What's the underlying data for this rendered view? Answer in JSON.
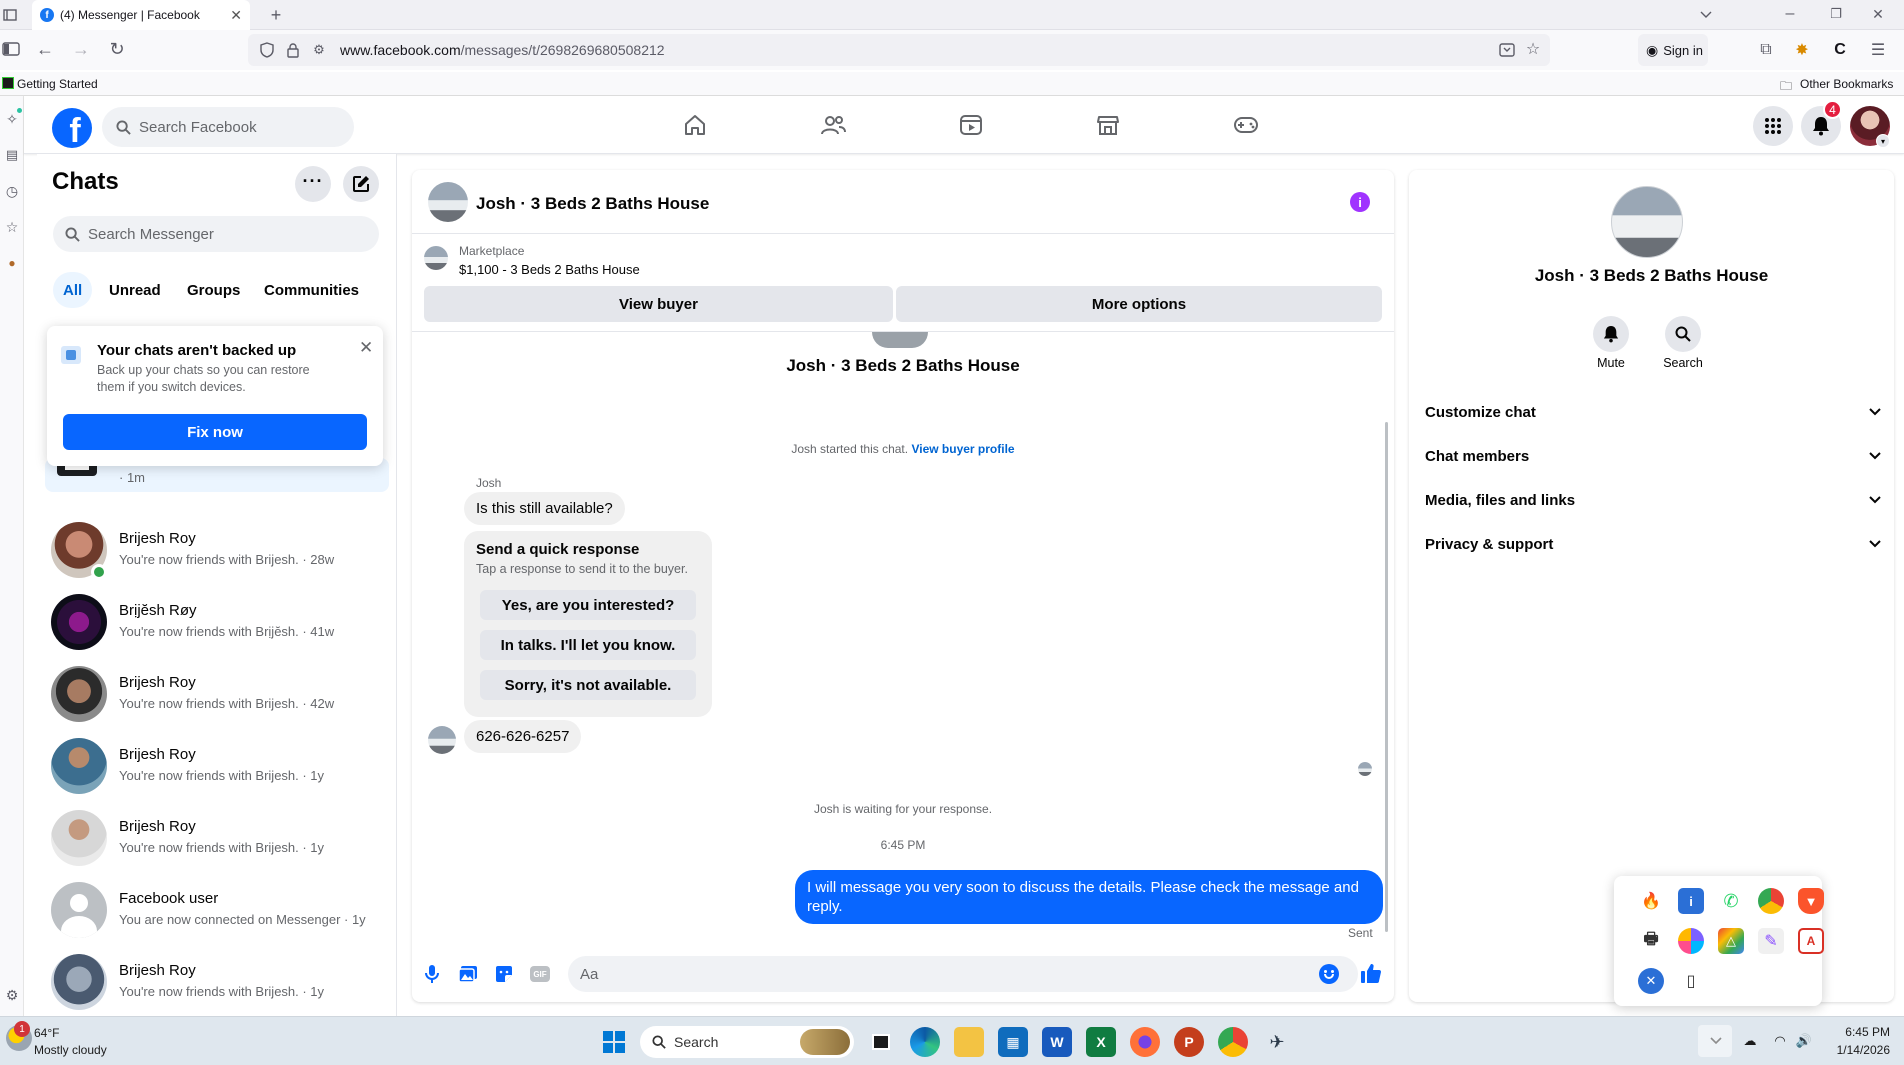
{
  "browser": {
    "tab_title": "(4) Messenger | Facebook",
    "url_domain": "www.facebook.com",
    "url_path": "/messages/t/2698269680508212",
    "sign_in": "Sign in",
    "bookmark_getting_started": "Getting Started",
    "bookmark_other": "Other Bookmarks"
  },
  "header": {
    "search_placeholder": "Search Facebook",
    "notification_count": "4"
  },
  "chats": {
    "title": "Chats",
    "search_placeholder": "Search Messenger",
    "filters": [
      "All",
      "Unread",
      "Groups",
      "Communities"
    ],
    "backup_title": "Your chats aren't backed up",
    "backup_body": "Back up your chats so you can restore them if you switch devices.",
    "fix_now": "Fix now",
    "partial_time": "· 1m",
    "rows": [
      {
        "name": "Brijesh Roy",
        "preview": "You're now friends with Brijesh. · 28w"
      },
      {
        "name": "Brịjĕsh Røy",
        "preview": "You're now friends with Brịjĕsh. · 41w"
      },
      {
        "name": "Brijesh Roy",
        "preview": "You're now friends with Brijesh. · 42w"
      },
      {
        "name": "Brijesh Roy",
        "preview": "You're now friends with Brijesh. · 1y"
      },
      {
        "name": "Brijesh Roy",
        "preview": "You're now friends with Brijesh. · 1y"
      },
      {
        "name": "Facebook user",
        "preview": "You are now connected on Messenger · 1y"
      },
      {
        "name": "Brijesh Roy",
        "preview": "You're now friends with Brijesh. · 1y"
      }
    ]
  },
  "conversation": {
    "title": "Josh · 3 Beds 2 Baths House",
    "marketplace_label": "Marketplace",
    "listing": "$1,100 - 3 Beds 2 Baths House",
    "view_buyer": "View buyer",
    "more_options": "More options",
    "center_name": "Josh · 3 Beds 2 Baths House",
    "started_note": "Josh started this chat.",
    "view_buyer_profile": "View buyer profile",
    "sender_name": "Josh",
    "msg1": "Is this still available?",
    "quick_title": "Send a quick response",
    "quick_sub": "Tap a response to send it to the buyer.",
    "quick_responses": [
      "Yes, are you interested?",
      "In talks. I'll let you know.",
      "Sorry, it's not available."
    ],
    "msg2": "626-626-6257",
    "waiting_note": "Josh is waiting for your response.",
    "time": "6:45 PM",
    "outgoing": "I will message you very soon to discuss the details. Please check the message and reply.",
    "sent": "Sent",
    "composer_placeholder": "Aa"
  },
  "info": {
    "name": "Josh · 3 Beds 2 Baths House",
    "mute": "Mute",
    "search": "Search",
    "sections": [
      "Customize chat",
      "Chat members",
      "Media, files and links",
      "Privacy & support"
    ]
  },
  "taskbar": {
    "weather_temp": "64°F",
    "weather_desc": "Mostly cloudy",
    "weather_badge": "1",
    "search_label": "Search",
    "clock_time": "6:45 PM",
    "clock_date": "1/14/2026"
  },
  "colors": {
    "fb_blue": "#0866ff",
    "link_blue": "#0064d1",
    "info_purple": "#a033ff"
  }
}
